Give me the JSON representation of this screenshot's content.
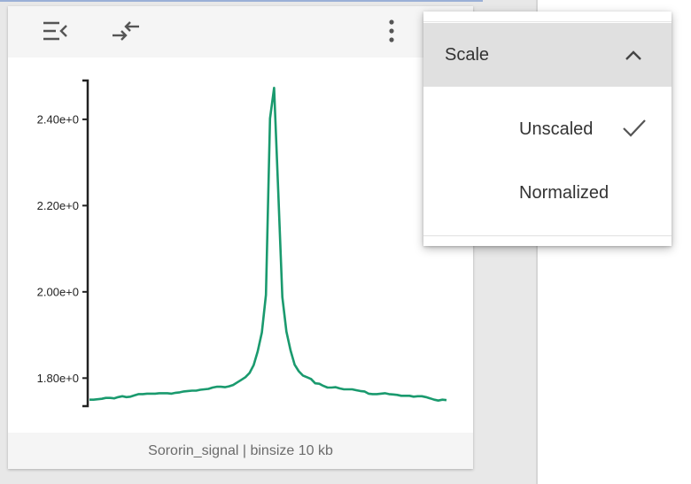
{
  "track": {
    "caption": "Sororin_signal | binsize 10 kb"
  },
  "toolbar": {
    "icons": [
      "collapse-panel-icon",
      "swap-icon",
      "more-vert-icon"
    ]
  },
  "menu": {
    "section_label": "Scale",
    "items": [
      {
        "label": "Unscaled",
        "selected": true
      },
      {
        "label": "Normalized",
        "selected": false
      }
    ]
  },
  "chart_data": {
    "type": "line",
    "title": "",
    "xlabel": "",
    "ylabel": "",
    "ylim": [
      1.735,
      2.49
    ],
    "y_tick_labels": [
      "2.40e+0",
      "2.20e+0",
      "2.00e+0",
      "1.80e+0"
    ],
    "y_ticks": [
      2.4,
      2.2,
      2.0,
      1.8
    ],
    "color": "#1a9a6e",
    "series": [
      {
        "values": [
          1.75,
          1.75,
          1.751,
          1.752,
          1.754,
          1.754,
          1.753,
          1.756,
          1.758,
          1.756,
          1.757,
          1.76,
          1.763,
          1.763,
          1.764,
          1.764,
          1.764,
          1.765,
          1.765,
          1.765,
          1.764,
          1.766,
          1.767,
          1.769,
          1.77,
          1.771,
          1.771,
          1.773,
          1.774,
          1.775,
          1.778,
          1.78,
          1.78,
          1.779,
          1.781,
          1.784,
          1.79,
          1.796,
          1.802,
          1.812,
          1.83,
          1.862,
          1.906,
          1.993,
          2.402,
          2.473,
          2.232,
          1.988,
          1.908,
          1.864,
          1.831,
          1.816,
          1.806,
          1.802,
          1.798,
          1.788,
          1.787,
          1.782,
          1.778,
          1.778,
          1.779,
          1.776,
          1.774,
          1.774,
          1.774,
          1.772,
          1.77,
          1.769,
          1.764,
          1.763,
          1.763,
          1.764,
          1.765,
          1.763,
          1.762,
          1.761,
          1.759,
          1.759,
          1.759,
          1.757,
          1.758,
          1.758,
          1.756,
          1.753,
          1.75,
          1.748,
          1.75,
          1.749
        ]
      }
    ],
    "grid": false,
    "legend": "none"
  }
}
